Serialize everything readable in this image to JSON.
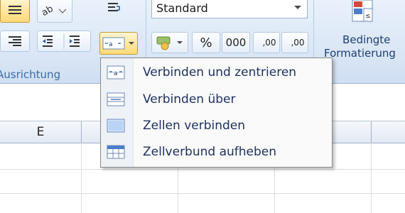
{
  "ribbon": {
    "group_alignment_label": "Ausrichtung",
    "number_format_value": "Standard",
    "percent_label": "%",
    "thousands_label": "000",
    "increase_decimal_label": ",00",
    "decrease_decimal_label": ",00",
    "conditional_formatting": {
      "line1": "Bedingte",
      "line2": "Formatierung"
    }
  },
  "merge_menu": {
    "items": [
      {
        "label": "Verbinden und zentrieren",
        "icon": "merge-center-icon"
      },
      {
        "label": "Verbinden über",
        "icon": "merge-across-icon"
      },
      {
        "label": "Zellen verbinden",
        "icon": "merge-cells-icon"
      },
      {
        "label": "Zellverbund aufheben",
        "icon": "unmerge-cells-icon"
      }
    ]
  },
  "sheet": {
    "columns": [
      "E"
    ]
  },
  "colors": {
    "ribbon_bg": "#dbe7f6",
    "group_label": "#3e6aa8",
    "active_button": "#ffd975",
    "menu_text": "#1c2f5e"
  }
}
